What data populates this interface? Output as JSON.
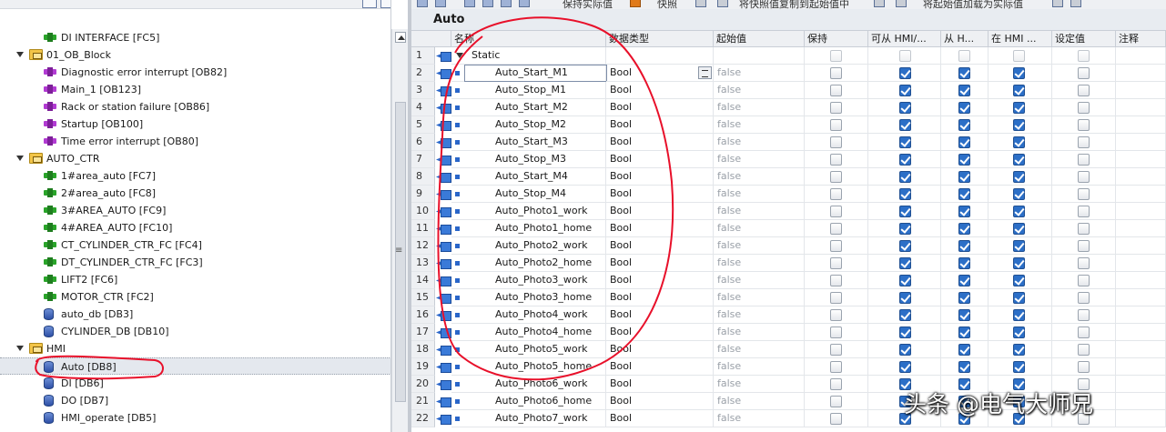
{
  "toolbar": {
    "keep_actual_label": "保持实际值",
    "snapshot_label": "快照",
    "copy_snapshot_label": "将快照值复制到起始值中",
    "load_start_label": "将起始值加载为实际值"
  },
  "tree": [
    {
      "label": "DI INTERFACE [FC5]",
      "kind": "fc",
      "level": 2
    },
    {
      "label": "01_OB_Block",
      "kind": "folder",
      "level": 1,
      "expanded": true
    },
    {
      "label": "Diagnostic error interrupt [OB82]",
      "kind": "ob",
      "level": 2
    },
    {
      "label": "Main_1 [OB123]",
      "kind": "ob",
      "level": 2
    },
    {
      "label": "Rack or station failure [OB86]",
      "kind": "ob",
      "level": 2
    },
    {
      "label": "Startup [OB100]",
      "kind": "ob",
      "level": 2
    },
    {
      "label": "Time error interrupt [OB80]",
      "kind": "ob",
      "level": 2
    },
    {
      "label": "AUTO_CTR",
      "kind": "folder",
      "level": 1,
      "expanded": true
    },
    {
      "label": "1#area_auto [FC7]",
      "kind": "fc",
      "level": 2
    },
    {
      "label": "2#area_auto [FC8]",
      "kind": "fc",
      "level": 2
    },
    {
      "label": "3#AREA_AUTO [FC9]",
      "kind": "fc",
      "level": 2
    },
    {
      "label": "4#AREA_AUTO [FC10]",
      "kind": "fc",
      "level": 2
    },
    {
      "label": "CT_CYLINDER_CTR_FC [FC4]",
      "kind": "fc",
      "level": 2
    },
    {
      "label": "DT_CYLINDER_CTR_FC [FC3]",
      "kind": "fc",
      "level": 2
    },
    {
      "label": "LIFT2 [FC6]",
      "kind": "fc",
      "level": 2
    },
    {
      "label": "MOTOR_CTR [FC2]",
      "kind": "fc",
      "level": 2
    },
    {
      "label": "auto_db [DB3]",
      "kind": "db",
      "level": 2
    },
    {
      "label": "CYLINDER_DB [DB10]",
      "kind": "db",
      "level": 2
    },
    {
      "label": "HMI",
      "kind": "folder",
      "level": 1,
      "expanded": true
    },
    {
      "label": "Auto [DB8]",
      "kind": "db",
      "level": 2,
      "selected": true
    },
    {
      "label": "DI [DB6]",
      "kind": "db",
      "level": 2
    },
    {
      "label": "DO [DB7]",
      "kind": "db",
      "level": 2
    },
    {
      "label": "HMI_operate [DB5]",
      "kind": "db",
      "level": 2
    }
  ],
  "editor": {
    "block_title": "Auto",
    "columns": [
      "名称",
      "数据类型",
      "起始值",
      "保持",
      "可从 HMI/...",
      "从 H...",
      "在 HMI ...",
      "设定值",
      "注释"
    ],
    "static_label": "Static",
    "rows": [
      {
        "num": "2",
        "name": "Auto_Start_M1",
        "type": "Bool",
        "default": "false"
      },
      {
        "num": "3",
        "name": "Auto_Stop_M1",
        "type": "Bool",
        "default": "false"
      },
      {
        "num": "4",
        "name": "Auto_Start_M2",
        "type": "Bool",
        "default": "false"
      },
      {
        "num": "5",
        "name": "Auto_Stop_M2",
        "type": "Bool",
        "default": "false"
      },
      {
        "num": "6",
        "name": "Auto_Start_M3",
        "type": "Bool",
        "default": "false"
      },
      {
        "num": "7",
        "name": "Auto_Stop_M3",
        "type": "Bool",
        "default": "false"
      },
      {
        "num": "8",
        "name": "Auto_Start_M4",
        "type": "Bool",
        "default": "false"
      },
      {
        "num": "9",
        "name": "Auto_Stop_M4",
        "type": "Bool",
        "default": "false"
      },
      {
        "num": "10",
        "name": "Auto_Photo1_work",
        "type": "Bool",
        "default": "false"
      },
      {
        "num": "11",
        "name": "Auto_Photo1_home",
        "type": "Bool",
        "default": "false"
      },
      {
        "num": "12",
        "name": "Auto_Photo2_work",
        "type": "Bool",
        "default": "false"
      },
      {
        "num": "13",
        "name": "Auto_Photo2_home",
        "type": "Bool",
        "default": "false"
      },
      {
        "num": "14",
        "name": "Auto_Photo3_work",
        "type": "Bool",
        "default": "false"
      },
      {
        "num": "15",
        "name": "Auto_Photo3_home",
        "type": "Bool",
        "default": "false"
      },
      {
        "num": "16",
        "name": "Auto_Photo4_work",
        "type": "Bool",
        "default": "false"
      },
      {
        "num": "17",
        "name": "Auto_Photo4_home",
        "type": "Bool",
        "default": "false"
      },
      {
        "num": "18",
        "name": "Auto_Photo5_work",
        "type": "Bool",
        "default": "false"
      },
      {
        "num": "19",
        "name": "Auto_Photo5_home",
        "type": "Bool",
        "default": "false"
      },
      {
        "num": "20",
        "name": "Auto_Photo6_work",
        "type": "Bool",
        "default": "false"
      },
      {
        "num": "21",
        "name": "Auto_Photo6_home",
        "type": "Bool",
        "default": "false"
      },
      {
        "num": "22",
        "name": "Auto_Photo7_work",
        "type": "Bool",
        "default": "false"
      }
    ]
  },
  "watermark": "头条 @电气大师兄",
  "colors": {
    "checkbox_on": "#2c6fc7",
    "annotation": "#e8102a",
    "tree_selected": "#e4e8ee"
  }
}
